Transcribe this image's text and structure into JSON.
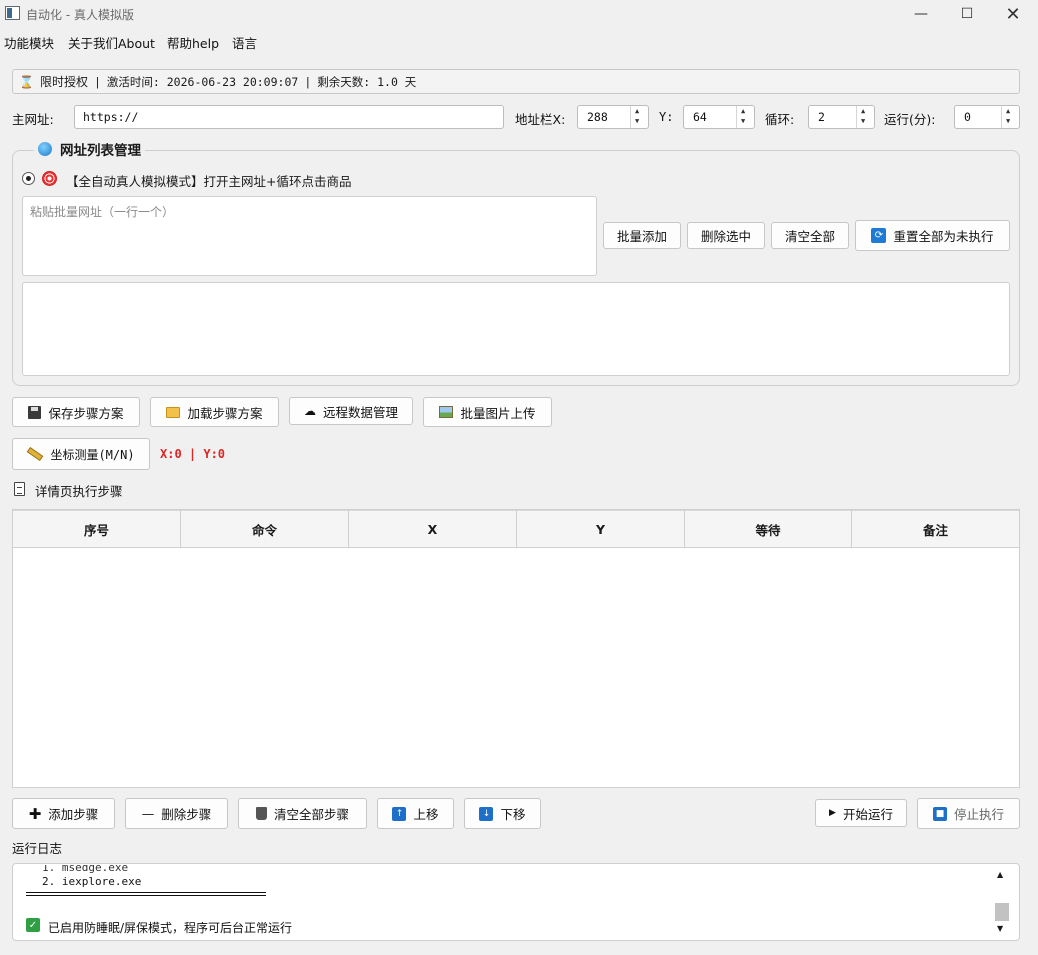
{
  "window": {
    "title": "自动化 - 真人模拟版"
  },
  "menu": [
    "功能模块",
    "关于我们About",
    "帮助help",
    "语言"
  ],
  "license": {
    "label": "限时授权",
    "activation": "激活时间: 2026-06-23 20:09:07",
    "remaining": "剩余天数: 1.0 天"
  },
  "url_row": {
    "main_label": "主网址:",
    "main_value": "https://",
    "x_label": "地址栏X:",
    "x_value": "288",
    "y_label": "Y:",
    "y_value": "64",
    "loop_label": "循环:",
    "loop_value": "2",
    "run_label": "运行(分):",
    "run_value": "0"
  },
  "url_group": {
    "title": "网址列表管理",
    "mode_label": "【全自动真人模拟模式】打开主网址+循环点击商品",
    "batch_placeholder": "粘贴批量网址（一行一个）",
    "buttons": {
      "add": "批量添加",
      "delete": "删除选中",
      "clear": "清空全部",
      "reset": "重置全部为未执行"
    }
  },
  "toolbar": {
    "save": "保存步骤方案",
    "load": "加载步骤方案",
    "remote": "远程数据管理",
    "upload": "批量图片上传"
  },
  "measure": {
    "button": "坐标测量(M/N)",
    "coords": "X:0 | Y:0"
  },
  "steps": {
    "title": "详情页执行步骤",
    "columns": [
      "序号",
      "命令",
      "X",
      "Y",
      "等待",
      "备注"
    ]
  },
  "step_buttons": {
    "add": "添加步骤",
    "delete": "删除步骤",
    "clear": "清空全部步骤",
    "up": "上移",
    "down": "下移",
    "start": "开始运行",
    "stop": "停止执行"
  },
  "log": {
    "title": "运行日志",
    "lines": [
      "1. msedge.exe",
      "2. iexplore.exe"
    ],
    "status": "已启用防睡眠/屏保模式，程序可后台正常运行"
  },
  "colors": {
    "coord_text": "#e02424",
    "group_border": "#cfcfcf",
    "status_check": "#2ea043"
  }
}
